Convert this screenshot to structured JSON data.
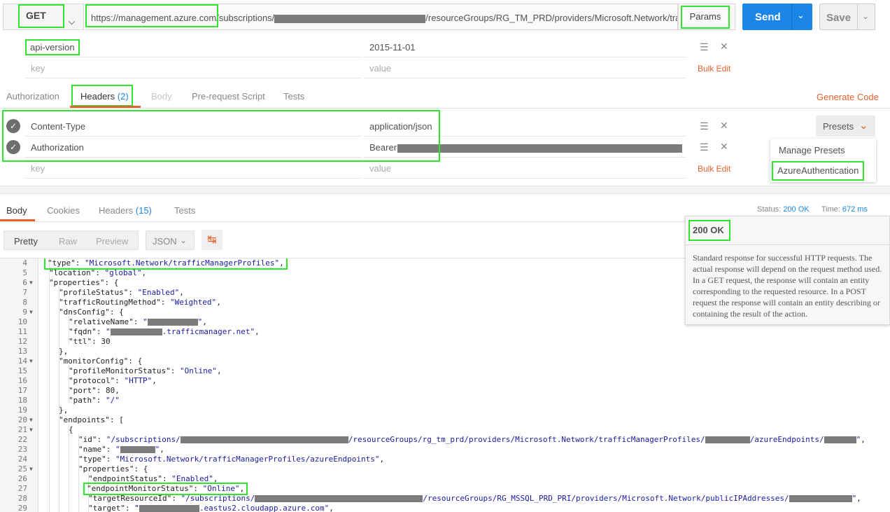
{
  "request": {
    "method": "GET",
    "url_host": "https://management.azure.com",
    "url_path_start": "/subscriptions/",
    "url_path_end": "/resourceGroups/RG_TM_PRD/providers/Microsoft.Network/traffic",
    "params_label": "Params",
    "send_label": "Send",
    "save_label": "Save"
  },
  "params": {
    "rows": [
      {
        "key": "api-version",
        "value": "2015-11-01"
      }
    ],
    "key_placeholder": "key",
    "value_placeholder": "value",
    "bulk_edit_label": "Bulk Edit"
  },
  "request_tabs": {
    "authorization": "Authorization",
    "headers": "Headers",
    "headers_count": "(2)",
    "body": "Body",
    "prerequest": "Pre-request Script",
    "tests": "Tests",
    "generate_code": "Generate Code"
  },
  "headers": {
    "rows": [
      {
        "key": "Content-Type",
        "value": "application/json"
      },
      {
        "key": "Authorization",
        "value": "Bearer"
      }
    ],
    "key_placeholder": "key",
    "value_placeholder": "value",
    "bulk_edit_label": "Bulk Edit",
    "presets_label": "Presets",
    "presets_menu": [
      "Manage Presets",
      "AzureAuthentication"
    ]
  },
  "response_tabs": {
    "body": "Body",
    "cookies": "Cookies",
    "headers": "Headers",
    "headers_count": "(15)",
    "tests": "Tests"
  },
  "response_status": {
    "status_label": "Status:",
    "status_value": "200 OK",
    "time_label": "Time:",
    "time_value": "672 ms"
  },
  "view": {
    "pretty": "Pretty",
    "raw": "Raw",
    "preview": "Preview",
    "format": "JSON"
  },
  "tooltip": {
    "title": "200 OK",
    "description": "Standard response for successful HTTP requests. The actual response will depend on the request method used. In a GET request, the response will contain an entity corresponding to the requested resource. In a POST request the response will contain an entity describing or containing the result of the action."
  },
  "code": {
    "l4": "4",
    "l5": "5",
    "l6": "6",
    "l7": "7",
    "l8": "8",
    "l9": "9",
    "l10": "10",
    "l11": "11",
    "l12": "12",
    "l13": "13",
    "l14": "14",
    "l15": "15",
    "l16": "16",
    "l17": "17",
    "l18": "18",
    "l19": "19",
    "l20": "20",
    "l21": "21",
    "l22": "22",
    "l23": "23",
    "l24": "24",
    "l25": "25",
    "l26": "26",
    "l27": "27",
    "l28": "28",
    "l29": "29",
    "type_key": "\"type\": ",
    "type_val": "\"Microsoft.Network/trafficManagerProfiles\"",
    "location_key": "\"location\": ",
    "location_val": "\"global\"",
    "properties_key": "\"properties\": {",
    "profileStatus_key": "\"profileStatus\": ",
    "profileStatus_val": "\"Enabled\"",
    "routing_key": "\"trafficRoutingMethod\": ",
    "routing_val": "\"Weighted\"",
    "dns_key": "\"dnsConfig\": {",
    "relname_key": "\"relativeName\": ",
    "fqdn_key": "\"fqdn\": ",
    "fqdn_val": ".trafficmanager.net\"",
    "ttl_key": "\"ttl\": ",
    "ttl_val": "30",
    "close_brace_comma": "},",
    "monitor_key": "\"monitorConfig\": {",
    "pms_key": "\"profileMonitorStatus\": ",
    "pms_val": "\"Online\"",
    "protocol_key": "\"protocol\": ",
    "protocol_val": "\"HTTP\"",
    "port_key": "\"port\": ",
    "port_val": "80",
    "path_key": "\"path\": ",
    "path_val": "\"/\"",
    "endpoints_key": "\"endpoints\": [",
    "open_brace": "{",
    "id_key": "\"id\": ",
    "id_val_1": "\"/subscriptions/",
    "id_val_2": "/resourceGroups/rg_tm_prd/providers/Microsoft.Network/trafficManagerProfiles/",
    "id_val_3": "/azureEndpoints/",
    "name_key": "\"name\": ",
    "type2_val": "\"Microsoft.Network/trafficManagerProfiles/azureEndpoints\"",
    "eps_key": "\"endpointStatus\": ",
    "eps_val": "\"Enabled\"",
    "ems_key": "\"endpointMonitorStatus\": ",
    "ems_val": "\"Online\"",
    "tri_key": "\"targetResourceId\": ",
    "tri_val_1": "\"/subscriptions/",
    "tri_val_2": "/resourceGroups/RG_MSSQL_PRD_PRI/providers/Microsoft.Network/publicIPAddresses/",
    "target_key": "\"target\": ",
    "target_val": ".eastus2.cloudapp.azure.com\""
  }
}
